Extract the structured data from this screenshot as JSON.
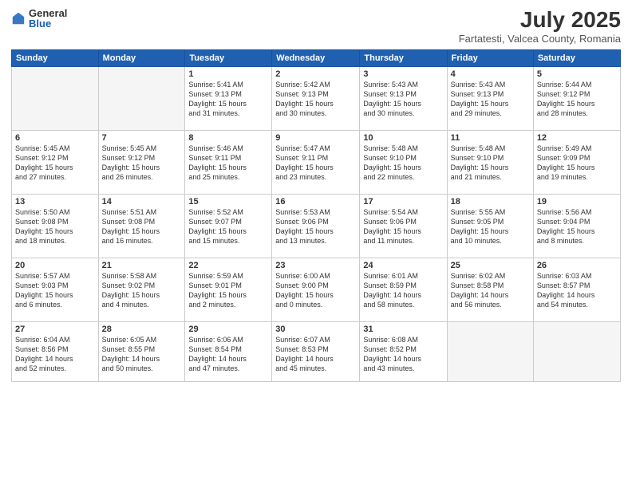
{
  "logo": {
    "general": "General",
    "blue": "Blue"
  },
  "title": "July 2025",
  "subtitle": "Fartatesti, Valcea County, Romania",
  "headers": [
    "Sunday",
    "Monday",
    "Tuesday",
    "Wednesday",
    "Thursday",
    "Friday",
    "Saturday"
  ],
  "weeks": [
    [
      {
        "day": "",
        "info": ""
      },
      {
        "day": "",
        "info": ""
      },
      {
        "day": "1",
        "info": "Sunrise: 5:41 AM\nSunset: 9:13 PM\nDaylight: 15 hours\nand 31 minutes."
      },
      {
        "day": "2",
        "info": "Sunrise: 5:42 AM\nSunset: 9:13 PM\nDaylight: 15 hours\nand 30 minutes."
      },
      {
        "day": "3",
        "info": "Sunrise: 5:43 AM\nSunset: 9:13 PM\nDaylight: 15 hours\nand 30 minutes."
      },
      {
        "day": "4",
        "info": "Sunrise: 5:43 AM\nSunset: 9:13 PM\nDaylight: 15 hours\nand 29 minutes."
      },
      {
        "day": "5",
        "info": "Sunrise: 5:44 AM\nSunset: 9:12 PM\nDaylight: 15 hours\nand 28 minutes."
      }
    ],
    [
      {
        "day": "6",
        "info": "Sunrise: 5:45 AM\nSunset: 9:12 PM\nDaylight: 15 hours\nand 27 minutes."
      },
      {
        "day": "7",
        "info": "Sunrise: 5:45 AM\nSunset: 9:12 PM\nDaylight: 15 hours\nand 26 minutes."
      },
      {
        "day": "8",
        "info": "Sunrise: 5:46 AM\nSunset: 9:11 PM\nDaylight: 15 hours\nand 25 minutes."
      },
      {
        "day": "9",
        "info": "Sunrise: 5:47 AM\nSunset: 9:11 PM\nDaylight: 15 hours\nand 23 minutes."
      },
      {
        "day": "10",
        "info": "Sunrise: 5:48 AM\nSunset: 9:10 PM\nDaylight: 15 hours\nand 22 minutes."
      },
      {
        "day": "11",
        "info": "Sunrise: 5:48 AM\nSunset: 9:10 PM\nDaylight: 15 hours\nand 21 minutes."
      },
      {
        "day": "12",
        "info": "Sunrise: 5:49 AM\nSunset: 9:09 PM\nDaylight: 15 hours\nand 19 minutes."
      }
    ],
    [
      {
        "day": "13",
        "info": "Sunrise: 5:50 AM\nSunset: 9:08 PM\nDaylight: 15 hours\nand 18 minutes."
      },
      {
        "day": "14",
        "info": "Sunrise: 5:51 AM\nSunset: 9:08 PM\nDaylight: 15 hours\nand 16 minutes."
      },
      {
        "day": "15",
        "info": "Sunrise: 5:52 AM\nSunset: 9:07 PM\nDaylight: 15 hours\nand 15 minutes."
      },
      {
        "day": "16",
        "info": "Sunrise: 5:53 AM\nSunset: 9:06 PM\nDaylight: 15 hours\nand 13 minutes."
      },
      {
        "day": "17",
        "info": "Sunrise: 5:54 AM\nSunset: 9:06 PM\nDaylight: 15 hours\nand 11 minutes."
      },
      {
        "day": "18",
        "info": "Sunrise: 5:55 AM\nSunset: 9:05 PM\nDaylight: 15 hours\nand 10 minutes."
      },
      {
        "day": "19",
        "info": "Sunrise: 5:56 AM\nSunset: 9:04 PM\nDaylight: 15 hours\nand 8 minutes."
      }
    ],
    [
      {
        "day": "20",
        "info": "Sunrise: 5:57 AM\nSunset: 9:03 PM\nDaylight: 15 hours\nand 6 minutes."
      },
      {
        "day": "21",
        "info": "Sunrise: 5:58 AM\nSunset: 9:02 PM\nDaylight: 15 hours\nand 4 minutes."
      },
      {
        "day": "22",
        "info": "Sunrise: 5:59 AM\nSunset: 9:01 PM\nDaylight: 15 hours\nand 2 minutes."
      },
      {
        "day": "23",
        "info": "Sunrise: 6:00 AM\nSunset: 9:00 PM\nDaylight: 15 hours\nand 0 minutes."
      },
      {
        "day": "24",
        "info": "Sunrise: 6:01 AM\nSunset: 8:59 PM\nDaylight: 14 hours\nand 58 minutes."
      },
      {
        "day": "25",
        "info": "Sunrise: 6:02 AM\nSunset: 8:58 PM\nDaylight: 14 hours\nand 56 minutes."
      },
      {
        "day": "26",
        "info": "Sunrise: 6:03 AM\nSunset: 8:57 PM\nDaylight: 14 hours\nand 54 minutes."
      }
    ],
    [
      {
        "day": "27",
        "info": "Sunrise: 6:04 AM\nSunset: 8:56 PM\nDaylight: 14 hours\nand 52 minutes."
      },
      {
        "day": "28",
        "info": "Sunrise: 6:05 AM\nSunset: 8:55 PM\nDaylight: 14 hours\nand 50 minutes."
      },
      {
        "day": "29",
        "info": "Sunrise: 6:06 AM\nSunset: 8:54 PM\nDaylight: 14 hours\nand 47 minutes."
      },
      {
        "day": "30",
        "info": "Sunrise: 6:07 AM\nSunset: 8:53 PM\nDaylight: 14 hours\nand 45 minutes."
      },
      {
        "day": "31",
        "info": "Sunrise: 6:08 AM\nSunset: 8:52 PM\nDaylight: 14 hours\nand 43 minutes."
      },
      {
        "day": "",
        "info": ""
      },
      {
        "day": "",
        "info": ""
      }
    ]
  ]
}
